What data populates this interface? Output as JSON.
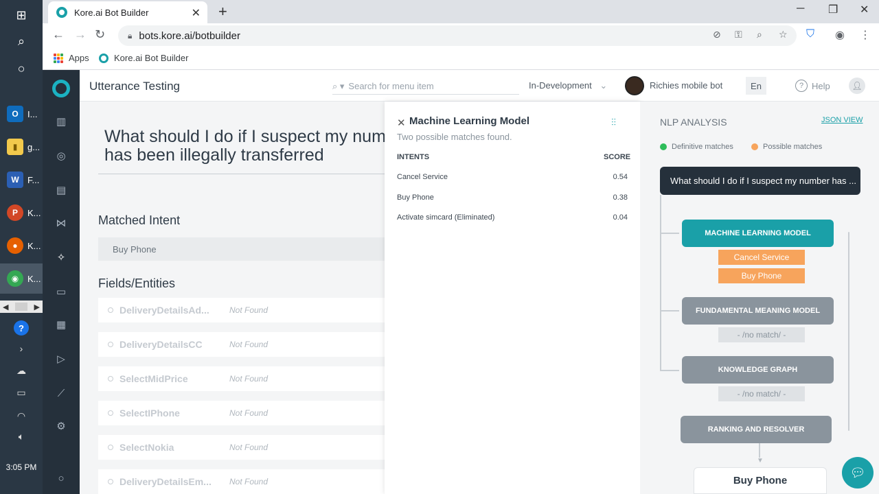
{
  "taskbar": {
    "apps": [
      {
        "label": "I...",
        "icon": "O",
        "color": "#0f6cbd"
      },
      {
        "label": "g...",
        "icon": "▮",
        "color": "#f2c94c"
      },
      {
        "label": "F...",
        "icon": "W",
        "color": "#2b5fb4"
      },
      {
        "label": "K...",
        "icon": "P",
        "color": "#d24726"
      },
      {
        "label": "K...",
        "icon": "●",
        "color": "#e66000"
      },
      {
        "label": "K...",
        "icon": "◉",
        "color": "#34a853"
      }
    ],
    "clock": "3:05 PM"
  },
  "browser": {
    "tab_title": "Kore.ai Bot Builder",
    "url": "bots.kore.ai/botbuilder",
    "bookmarks": [
      {
        "label": "Apps"
      },
      {
        "label": "Kore.ai Bot Builder"
      }
    ]
  },
  "header": {
    "page_title": "Utterance Testing",
    "search_placeholder": "Search for menu item",
    "environment": "In-Development",
    "bot_name": "Richies mobile bot",
    "language": "En",
    "help": "Help"
  },
  "main": {
    "utterance": "What should I do if I suspect my number has been illegally transferred",
    "matched_intent_title": "Matched Intent",
    "matched_intent": "Buy Phone",
    "entities_title": "Fields/Entities",
    "entities": [
      {
        "name": "DeliveryDetailsAd...",
        "status": "Not Found"
      },
      {
        "name": "DeliveryDetailsCC",
        "status": "Not Found"
      },
      {
        "name": "SelectMidPrice",
        "status": "Not Found"
      },
      {
        "name": "SelectIPhone",
        "status": "Not Found"
      },
      {
        "name": "SelectNokia",
        "status": "Not Found"
      },
      {
        "name": "DeliveryDetailsEm...",
        "status": "Not Found"
      }
    ]
  },
  "ml_panel": {
    "title": "Machine Learning Model",
    "subtitle": "Two possible matches found.",
    "col_intents": "INTENTS",
    "col_score": "SCORE",
    "rows": [
      {
        "intent": "Cancel Service",
        "score": "0.54"
      },
      {
        "intent": "Buy Phone",
        "score": "0.38"
      },
      {
        "intent": "Activate simcard (Eliminated)",
        "score": "0.04"
      }
    ]
  },
  "nlp": {
    "title": "NLP ANALYSIS",
    "json_view": "JSON VIEW",
    "legend_definitive": "Definitive matches",
    "legend_possible": "Possible matches",
    "utterance_short": "What should I do if I suspect my number has ...",
    "stages": [
      {
        "label": "MACHINE LEARNING MODEL",
        "tags": [
          "Cancel Service",
          "Buy Phone"
        ]
      },
      {
        "label": "FUNDAMENTAL MEANING MODEL",
        "tags": [
          "- /no match/ -"
        ]
      },
      {
        "label": "KNOWLEDGE GRAPH",
        "tags": [
          "- /no match/ -"
        ]
      },
      {
        "label": "RANKING AND RESOLVER",
        "tags": []
      }
    ],
    "result": "Buy Phone"
  },
  "colors": {
    "accent": "#1aa0a8",
    "possible": "#f7a45c",
    "definitive": "#2ebd5a",
    "dark": "#25303b"
  }
}
